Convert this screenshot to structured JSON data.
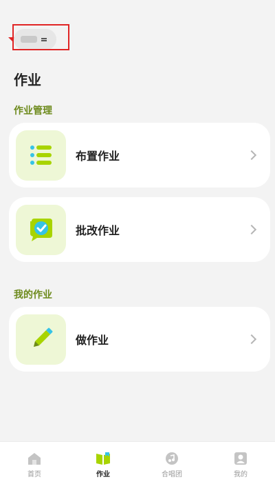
{
  "page_title": "作业",
  "sections": [
    {
      "label": "作业管理",
      "items": [
        {
          "label": "布置作业",
          "icon": "list-icon"
        },
        {
          "label": "批改作业",
          "icon": "check-badge-icon"
        }
      ]
    },
    {
      "label": "我的作业",
      "items": [
        {
          "label": "做作业",
          "icon": "pencil-icon"
        }
      ]
    }
  ],
  "tabbar": {
    "tabs": [
      {
        "label": "首页",
        "icon": "home-icon"
      },
      {
        "label": "作业",
        "icon": "book-icon",
        "active": true
      },
      {
        "label": "合唱团",
        "icon": "music-icon"
      },
      {
        "label": "我的",
        "icon": "user-icon"
      }
    ]
  },
  "colors": {
    "accent": "#a8d400",
    "accent_dark": "#6d8a1c",
    "icon_tile_bg": "#eef7d6",
    "highlight": "#e02424"
  }
}
